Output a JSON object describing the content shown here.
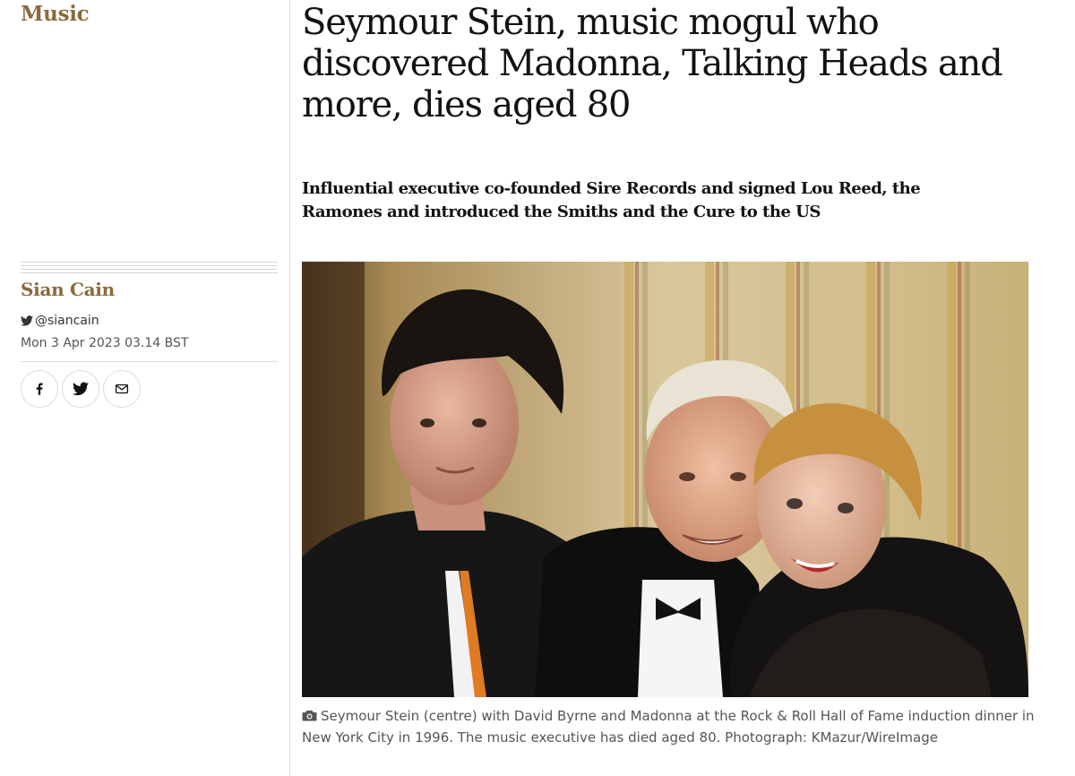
{
  "section": {
    "label": "Music"
  },
  "article": {
    "headline": "Seymour Stein, music mogul who discovered Madonna, Talking Heads and more, dies aged 80",
    "standfirst": "Influential executive co-founded Sire Records and signed Lou Reed, the Ramones and introduced the Smiths and the Cure to the US"
  },
  "byline": {
    "author": "Sian Cain",
    "twitter_handle": "@siancain",
    "date": "Mon 3 Apr 2023 03.14 BST"
  },
  "share": {
    "icons": [
      "facebook-icon",
      "twitter-icon",
      "email-icon"
    ]
  },
  "image": {
    "caption": "Seymour Stein (centre) with David Byrne and Madonna at the Rock & Roll Hall of Fame induction dinner in New York City in 1996. The music executive has died aged 80. Photograph: KMazur/WireImage"
  },
  "colors": {
    "section_accent": "#8a6a3c",
    "text": "#121212",
    "muted": "#555555",
    "rule": "#dcdcdc"
  }
}
